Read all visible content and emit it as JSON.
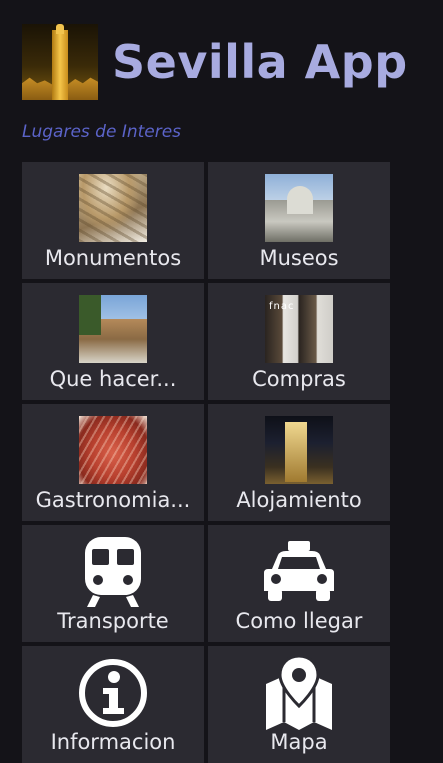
{
  "header": {
    "app_title": "Sevilla App",
    "logo_icon": "giralda-logo"
  },
  "section": {
    "title": "Lugares de Interes"
  },
  "tiles": [
    {
      "label": "Monumentos",
      "icon": "monumentos-thumbnail"
    },
    {
      "label": "Museos",
      "icon": "museos-thumbnail"
    },
    {
      "label": "Que hacer...",
      "icon": "que-hacer-thumbnail"
    },
    {
      "label": "Compras",
      "icon": "compras-thumbnail"
    },
    {
      "label": "Gastronomia...",
      "icon": "gastronomia-thumbnail"
    },
    {
      "label": "Alojamiento",
      "icon": "alojamiento-thumbnail"
    },
    {
      "label": "Transporte",
      "icon": "train-icon"
    },
    {
      "label": "Como llegar",
      "icon": "taxi-icon"
    },
    {
      "label": "Informacion",
      "icon": "info-icon"
    },
    {
      "label": "Mapa",
      "icon": "map-pin-icon"
    }
  ],
  "colors": {
    "background": "#141318",
    "tile": "#2b2a31",
    "title": "#a8abe0",
    "section": "#5b63c8",
    "label": "#e8e8ee"
  }
}
